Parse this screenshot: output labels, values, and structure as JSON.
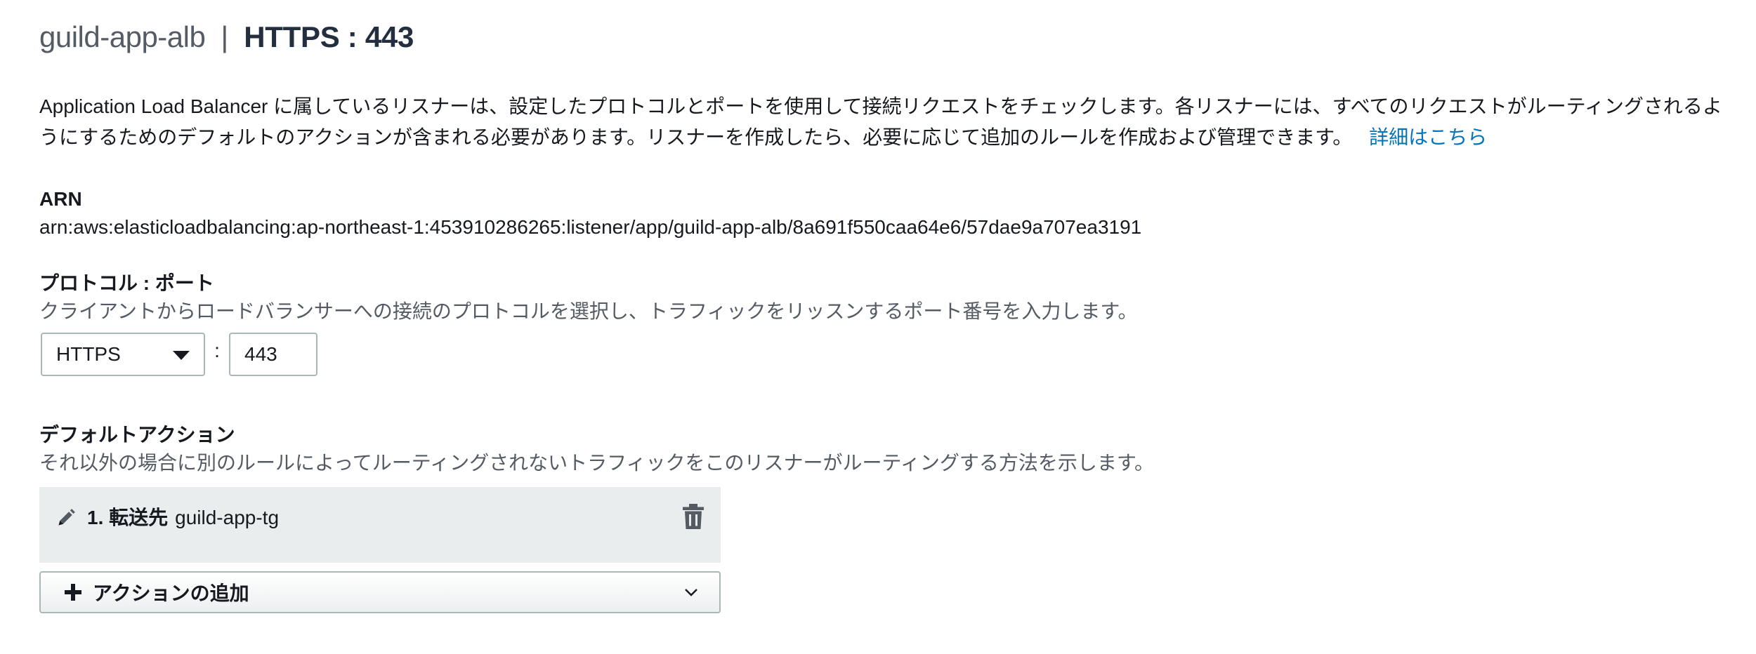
{
  "header": {
    "lb_name": "guild-app-alb",
    "separator": "|",
    "listener": "HTTPS : 443"
  },
  "description": {
    "text": "Application Load Balancer に属しているリスナーは、設定したプロトコルとポートを使用して接続リクエストをチェックします。各リスナーには、すべてのリクエストがルーティングされるようにするためのデフォルトのアクションが含まれる必要があります。リスナーを作成したら、必要に応じて追加のルールを作成および管理できます。",
    "learn_more": "詳細はこちら"
  },
  "arn": {
    "label": "ARN",
    "value": "arn:aws:elasticloadbalancing:ap-northeast-1:453910286265:listener/app/guild-app-alb/8a691f550caa64e6/57dae9a707ea3191"
  },
  "protocol": {
    "label": "プロトコル : ポート",
    "helper": "クライアントからロードバランサーへの接続のプロトコルを選択し、トラフィックをリッスンするポート番号を入力します。",
    "selected": "HTTPS",
    "colon": ":",
    "port": "443"
  },
  "default_action": {
    "label": "デフォルトアクション",
    "helper": "それ以外の場合に別のルールによってルーティングされないトラフィックをこのリスナーがルーティングする方法を示します。",
    "item_prefix": "1. 転送先",
    "item_target": "guild-app-tg",
    "add_label": "アクションの追加"
  },
  "icons": {
    "edit": "pencil-icon",
    "delete": "trash-icon",
    "add": "plus-icon",
    "dropdown": "chevron-down-icon"
  },
  "colors": {
    "link": "#0073bb",
    "card_bg": "#eaeded",
    "border": "#aab7b8"
  }
}
